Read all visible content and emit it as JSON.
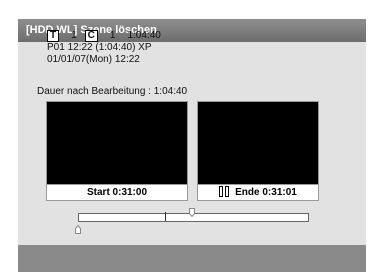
{
  "window": {
    "title": "[HDD WL] Szene löschen"
  },
  "info": {
    "title_badge": "T",
    "title_number": "1",
    "chapter_badge": "C",
    "chapter_number": "1",
    "total_time": "1:04:40",
    "program_line": "P01  12:22 (1:04:40) XP",
    "date_line": "01/01/07(Mon)  12:22",
    "duration_after_edit": "Dauer nach Bearbeitung : 1:04:40"
  },
  "preview_start": {
    "label": "Start  0:31:00"
  },
  "preview_end": {
    "label": "Ende  0:31:01",
    "icon": "pause-icon"
  },
  "timeline": {
    "start_marker_position": 0.0,
    "current_position": 0.5
  },
  "colors": {
    "titlebar": "#7a7a7a",
    "panel": "#e2e2e2",
    "screen": "#000000"
  }
}
